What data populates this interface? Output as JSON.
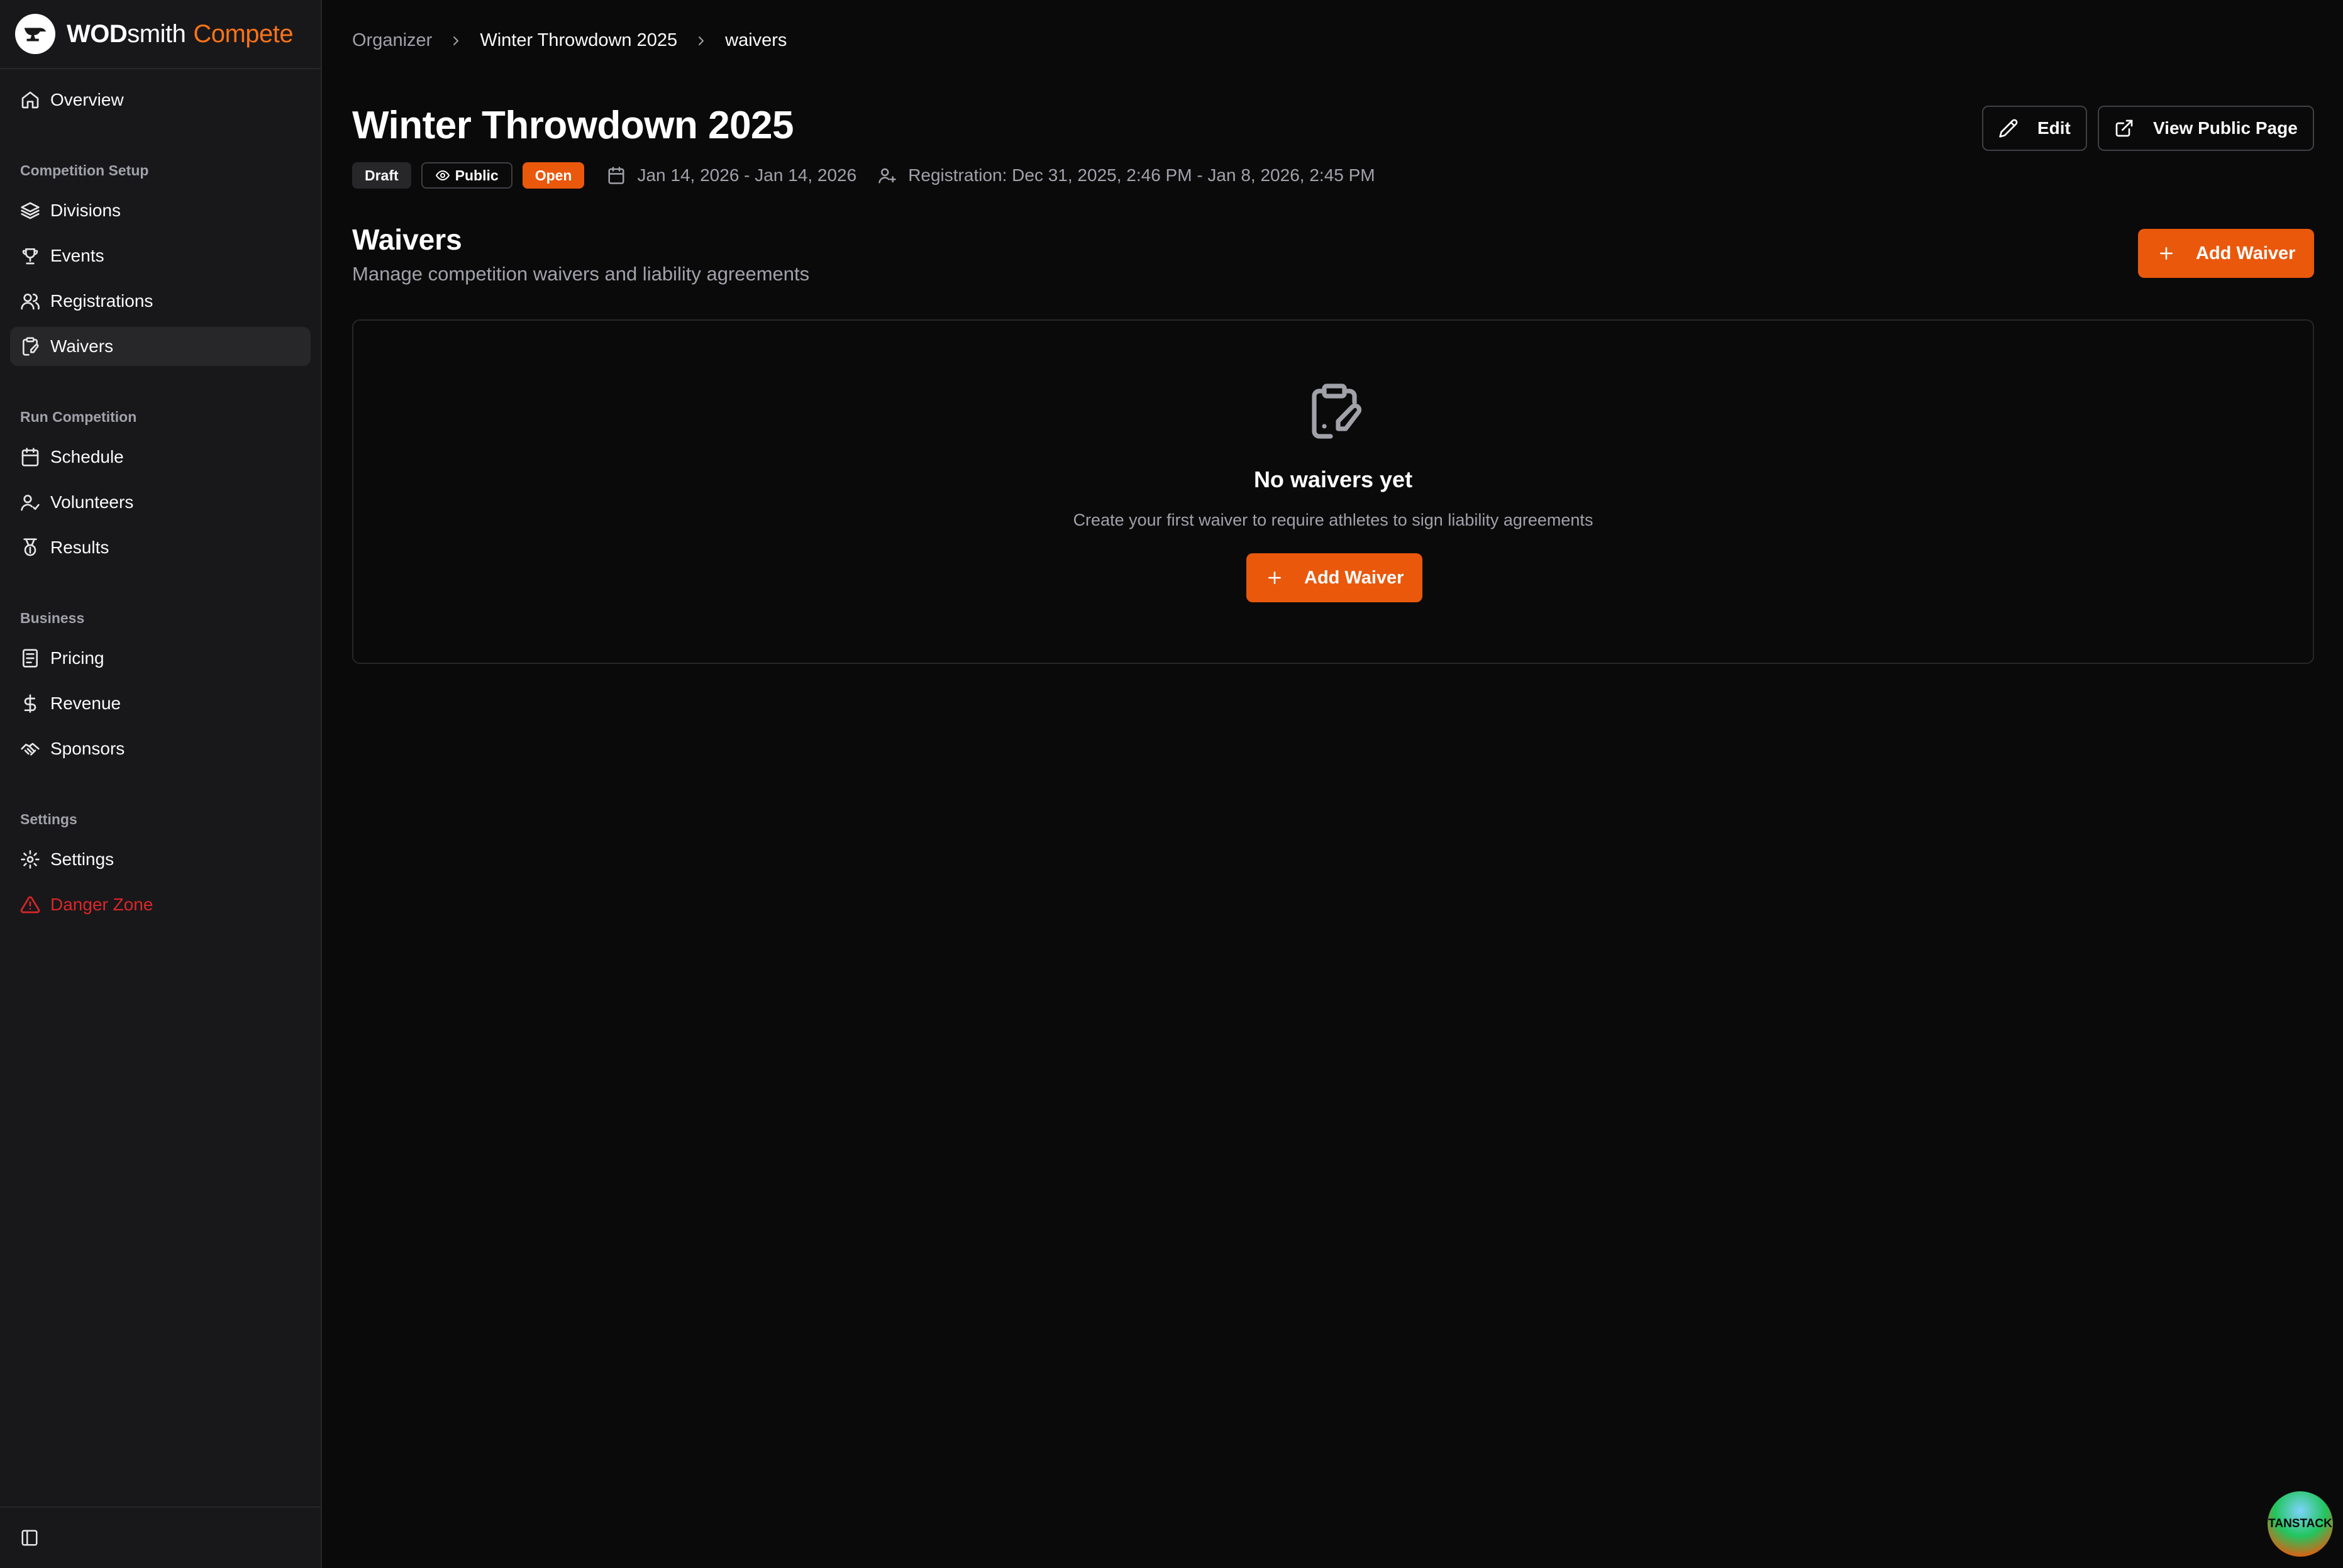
{
  "brand": {
    "part1": "WOD",
    "part2": "smith",
    "part3": "Compete"
  },
  "sidebar": {
    "overview": "Overview",
    "groups": {
      "setup": "Competition Setup",
      "run": "Run Competition",
      "business": "Business",
      "settings": "Settings"
    },
    "items": {
      "divisions": "Divisions",
      "events": "Events",
      "registrations": "Registrations",
      "waivers": "Waivers",
      "schedule": "Schedule",
      "volunteers": "Volunteers",
      "results": "Results",
      "pricing": "Pricing",
      "revenue": "Revenue",
      "sponsors": "Sponsors",
      "settings": "Settings",
      "danger_zone": "Danger Zone"
    },
    "active": "waivers"
  },
  "breadcrumb": {
    "root": "Organizer",
    "competition": "Winter Throwdown 2025",
    "current": "waivers"
  },
  "header": {
    "title": "Winter Throwdown 2025",
    "badges": {
      "draft": "Draft",
      "public": "Public",
      "open": "Open"
    },
    "dates": "Jan 14, 2026 - Jan 14, 2026",
    "registration": "Registration: Dec 31, 2025, 2:46 PM - Jan 8, 2026, 2:45 PM",
    "edit_label": "Edit",
    "view_public_label": "View Public Page"
  },
  "section": {
    "title": "Waivers",
    "description": "Manage competition waivers and liability agreements",
    "add_label": "Add Waiver"
  },
  "empty_state": {
    "title": "No waivers yet",
    "description": "Create your first waiver to require athletes to sign liability agreements",
    "add_label": "Add Waiver"
  },
  "devtools": {
    "label": "TANSTACK"
  },
  "colors": {
    "accent": "#ea580c",
    "brand_accent": "#f97316",
    "danger": "#dc2626",
    "background": "#0a0a0a",
    "sidebar": "#18181b"
  }
}
